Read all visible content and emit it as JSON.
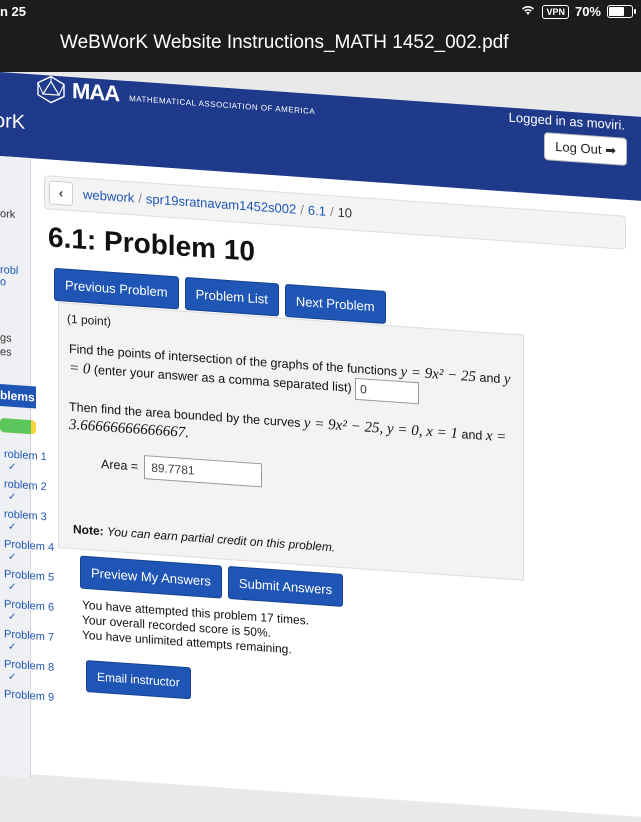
{
  "status": {
    "time": "n 25",
    "vpn": "VPN",
    "battery": "70%",
    "battery_level": 0.7
  },
  "document_title": "WeBWorK Website Instructions_MATH 1452_002.pdf",
  "header": {
    "logo_text": "MAA",
    "logo_subtitle": "MATHEMATICAL ASSOCIATION OF AMERICA",
    "site_name_fragment": "orK",
    "logged_in": "Logged in as moviri.",
    "logout_label": "Log Out"
  },
  "sidebar": {
    "fragments": [
      "ork",
      "robl",
      "o",
      "gs",
      "es"
    ],
    "section_title": "blems",
    "progress_fraction": 0.85,
    "problems": [
      "roblem 1",
      "roblem 2",
      "roblem 3",
      "Problem 4",
      "Problem 5",
      "Problem 6",
      "Problem 7",
      "Problem 8",
      "Problem 9"
    ],
    "check": "✓"
  },
  "breadcrumb": {
    "back": "‹",
    "items": [
      "webwork",
      "spr19sratnavam1452s002",
      "6.1",
      "10"
    ]
  },
  "page_title": "6.1: Problem 10",
  "nav_buttons": [
    "Previous Problem",
    "Problem List",
    "Next Problem"
  ],
  "problem": {
    "points": "(1 point)",
    "q1_a": "Find the points of intersection of the graphs of the functions",
    "q1_math": "y = 9x² − 25",
    "q1_b": "and",
    "q1_math2": "y = 0",
    "q1_c": "(enter your answer as a comma separated list)",
    "answer1": "0",
    "q2_a": "Then find the area bounded by the curves",
    "q2_math": "y = 9x² − 25, y = 0, x = 1",
    "q2_b": "and",
    "q2_math2": "x = 3.66666666666667.",
    "area_label": "Area =",
    "area_value": "89.7781",
    "note_label": "Note:",
    "note_text": "You can earn partial credit on this problem."
  },
  "actions": [
    "Preview My Answers",
    "Submit Answers"
  ],
  "attempts": [
    "You have attempted this problem 17 times.",
    "Your overall recorded score is 50%.",
    "You have unlimited attempts remaining."
  ],
  "email_label": "Email instructor"
}
